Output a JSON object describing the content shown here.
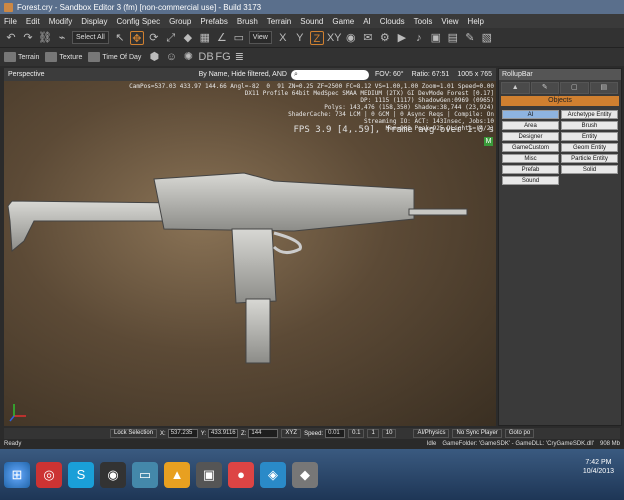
{
  "window": {
    "title": "Forest.cry - Sandbox Editor 3 (fm) [non-commercial use] - Build 3173"
  },
  "menu": [
    "File",
    "Edit",
    "Modify",
    "Display",
    "Config Spec",
    "Group",
    "Prefabs",
    "Brush",
    "Terrain",
    "Sound",
    "Game",
    "AI",
    "Clouds",
    "Tools",
    "View",
    "Help"
  ],
  "toolbar": {
    "select_all": "Select All",
    "view": "View",
    "axes": [
      "X",
      "Y",
      "Z",
      "XY"
    ]
  },
  "toolbar2": {
    "terrain": "Terrain",
    "texture": "Texture",
    "time_of_day": "Time Of Day",
    "db": "DB",
    "fg": "FG"
  },
  "viewport": {
    "mode": "Perspective",
    "filter": "By Name, Hide filtered, AND",
    "fov_label": "FOV:",
    "fov": "60°",
    "ratio_label": "Ratio:",
    "ratio": "67:51",
    "resolution": "1005 x 765",
    "info": "CamPos=537.03 433.97 144.66 Angl=-82  0  91 ZN=0.25 ZF=2500 FC=8.12 VS=1.00,1.00 Zoom=1.01 Speed=0.00\nDX11 Profile 64bit MedSpec SMAA MEDIUM (2TX) GI DevMode Forest [0.17]\nDP: 1115 (1117) ShadowGen:0969 (0965)\nPolys: 143,476 (158,350) Shadow:38,744 (23,924)\nShaderCache: 734 LCM | 0 GCM | 0 Async Reqs | Compile: On\nStreaming IO: ACT: 143Insec, Jobs:10\nMem=908 Peak=925 DLights=(4/2)",
    "fps": "FPS 3.9 [4,.59], frame avg over 1.0 s",
    "m_badge": "M"
  },
  "rollup": {
    "title": "RollupBar",
    "objects": "Objects",
    "buttons": [
      "AI",
      "Archetype Entity",
      "Area",
      "Brush",
      "Designer",
      "Entity",
      "GameCustom",
      "Geom Entity",
      "Misc",
      "Particle Entity",
      "Prefab",
      "Solid",
      "Sound"
    ]
  },
  "statusbar": {
    "lock_selection": "Lock Selection",
    "x_label": "X:",
    "x": "537.235",
    "y_label": "Y:",
    "y": "433.9116",
    "z_label": "Z:",
    "z": "144",
    "xyz": "XYZ",
    "speed_label": "Speed:",
    "speed": "0.01",
    "speed_opts": [
      "0.1",
      "1",
      "10"
    ],
    "ai_physics": "AI/Physics",
    "no_sync": "No Sync Player",
    "goto": "Goto po"
  },
  "readybar": {
    "status": "Ready",
    "idle": "Idle",
    "gamefolder": "GameFolder: 'GameSDK' - GameDLL: 'CryGameSDK.dll'",
    "mem": "908 Mb"
  },
  "clock": {
    "time": "7:42 PM",
    "date": "10/4/2013"
  }
}
